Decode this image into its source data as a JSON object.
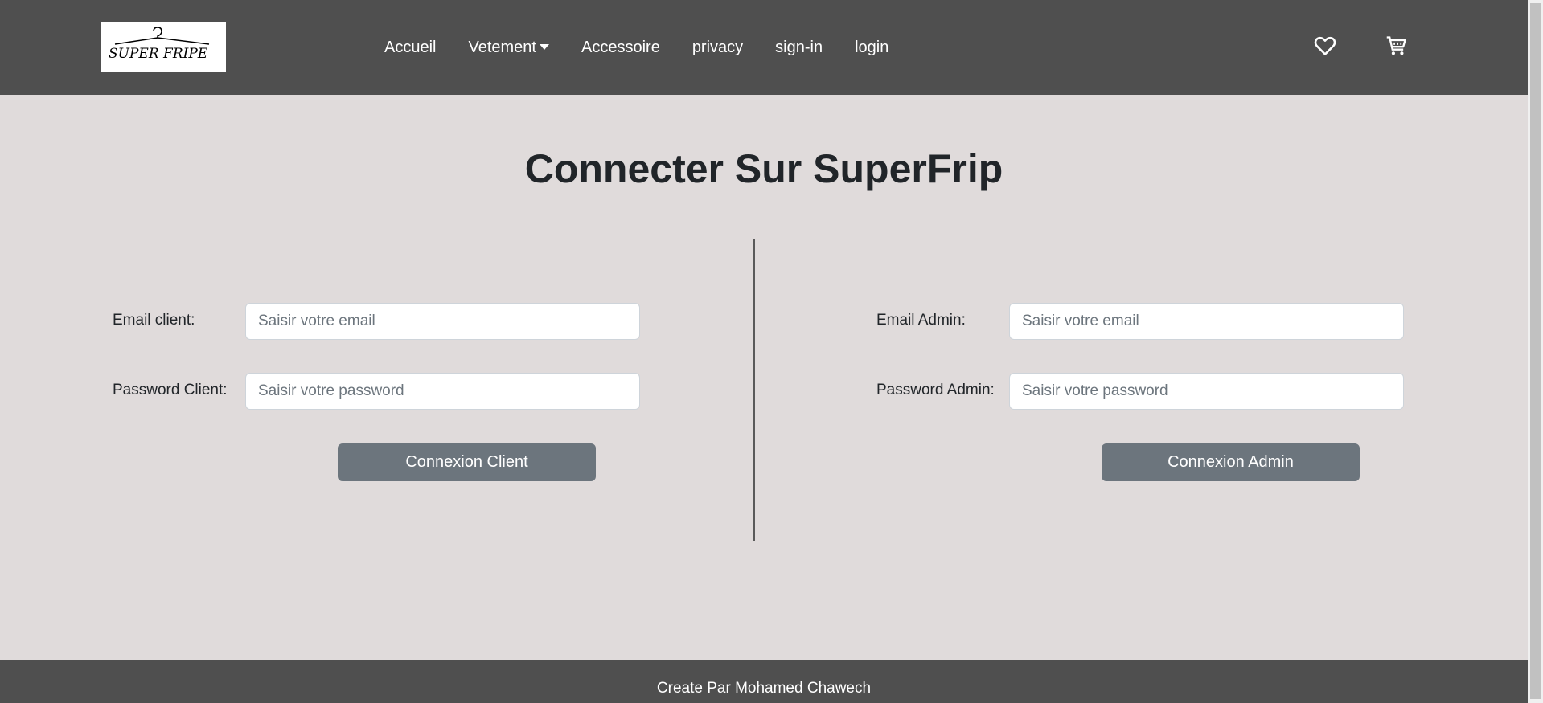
{
  "brand": {
    "logo_text": "SUPER FRIPE"
  },
  "nav": {
    "items": [
      {
        "label": "Accueil"
      },
      {
        "label": "Vetement"
      },
      {
        "label": "Accessoire"
      },
      {
        "label": "privacy"
      },
      {
        "label": "sign-in"
      },
      {
        "label": "login"
      }
    ],
    "icons": [
      "heart-icon",
      "cart-icon"
    ]
  },
  "page": {
    "title": "Connecter Sur SuperFrip"
  },
  "client_form": {
    "email_label": "Email client:",
    "email_placeholder": "Saisir votre email",
    "password_label": "Password Client:",
    "password_placeholder": "Saisir votre password",
    "submit_label": "Connexion Client"
  },
  "admin_form": {
    "email_label": "Email Admin:",
    "email_placeholder": "Saisir votre email",
    "password_label": "Password Admin:",
    "password_placeholder": "Saisir votre password",
    "submit_label": "Connexion Admin"
  },
  "footer": {
    "text": "Create Par Mohamed Chawech"
  },
  "colors": {
    "navbar_bg": "#4f4f4f",
    "page_bg": "#e0dbdb",
    "button_bg": "#6c757d",
    "text_dark": "#212529"
  }
}
